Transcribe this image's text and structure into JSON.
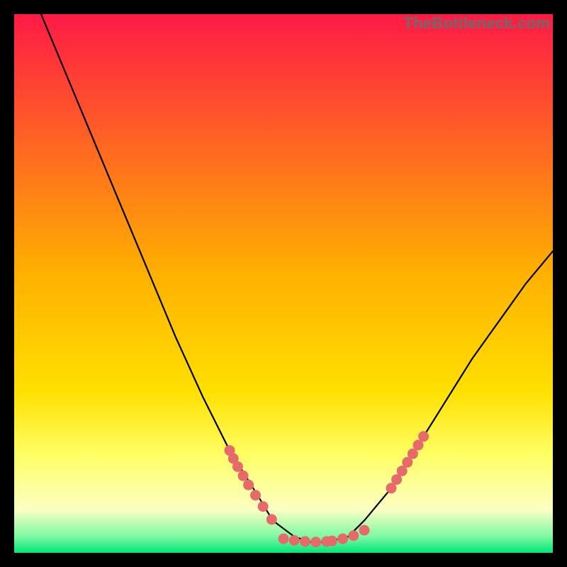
{
  "watermark": "TheBottleneck.com",
  "colors": {
    "black": "#000000",
    "gradient_top": "#ff1a46",
    "gradient_mid": "#ffd000",
    "gradient_lightyellow": "#ffff66",
    "gradient_paleyellow": "#fbffc2",
    "gradient_green": "#00e676",
    "curve": "#000000",
    "dots": "#e66a6a"
  },
  "chart_data": {
    "type": "line",
    "title": "",
    "xlabel": "",
    "ylabel": "",
    "xlim": [
      0,
      100
    ],
    "ylim": [
      0,
      100
    ],
    "series": [
      {
        "name": "bottleneck-curve",
        "x": [
          5,
          10,
          15,
          20,
          25,
          30,
          35,
          40,
          45,
          48,
          52,
          55,
          58,
          62,
          65,
          70,
          75,
          80,
          85,
          90,
          95,
          100
        ],
        "values": [
          100,
          88,
          76,
          64,
          52,
          40,
          29,
          19,
          11,
          6,
          3,
          2,
          2,
          3,
          6,
          12,
          20,
          28,
          36,
          43,
          50,
          56
        ]
      }
    ],
    "dot_clusters": [
      {
        "name": "left-cluster",
        "x": [
          40.0,
          40.7,
          41.5,
          42.5,
          43.5,
          44.8,
          46.2,
          47.8
        ],
        "values": [
          19.0,
          17.5,
          16.0,
          14.3,
          12.6,
          10.7,
          8.6,
          6.2
        ]
      },
      {
        "name": "bottom-cluster",
        "x": [
          50.0,
          52.0,
          54.0,
          56.0,
          58.0,
          59.0,
          61.0,
          63.0,
          65.0
        ],
        "values": [
          2.6,
          2.3,
          2.1,
          2.0,
          2.1,
          2.2,
          2.6,
          3.2,
          4.2
        ]
      },
      {
        "name": "right-cluster",
        "x": [
          70.0,
          71.0,
          72.0,
          73.0,
          74.0,
          75.0,
          76.0
        ],
        "values": [
          12.0,
          13.6,
          15.2,
          16.8,
          18.4,
          20.0,
          21.6
        ]
      }
    ]
  }
}
